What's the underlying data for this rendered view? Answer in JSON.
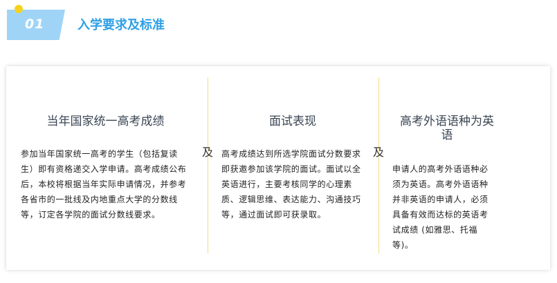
{
  "section": {
    "number": "01",
    "title": "入学要求及标准"
  },
  "connector": "及",
  "columns": [
    {
      "title": "当年国家统一高考成绩",
      "body": "参加当年国家统一高考的学生（包括复读生）即有资格递交入学申请。高考成绩公布后，本校将根据当年实际申请情况，并参考各省市的一批线及内地重点大学的分数线等，订定各学院的面试分数线要求。"
    },
    {
      "title": "面试表现",
      "body": "高考成绩达到所选学院面试分数要求即获邀参加该学院的面试。面试以全英语进行，主要考核同学的心理素质、逻辑思维、表达能力、沟通技巧等，通过面试即可获录取。"
    },
    {
      "title": "高考外语语种为英语",
      "body": "申请人的高考外语语种必须为英语。高考外语语种并非英语的申请人，必须具备有效而达标的英语考试成绩 (如雅思、托福等)。"
    }
  ],
  "colors": {
    "accent_blue": "#2e9fe6",
    "tab_blue": "#9fd4f7",
    "dot_yellow": "#f6d21c",
    "divider_yellow": "#f0dc8a"
  }
}
